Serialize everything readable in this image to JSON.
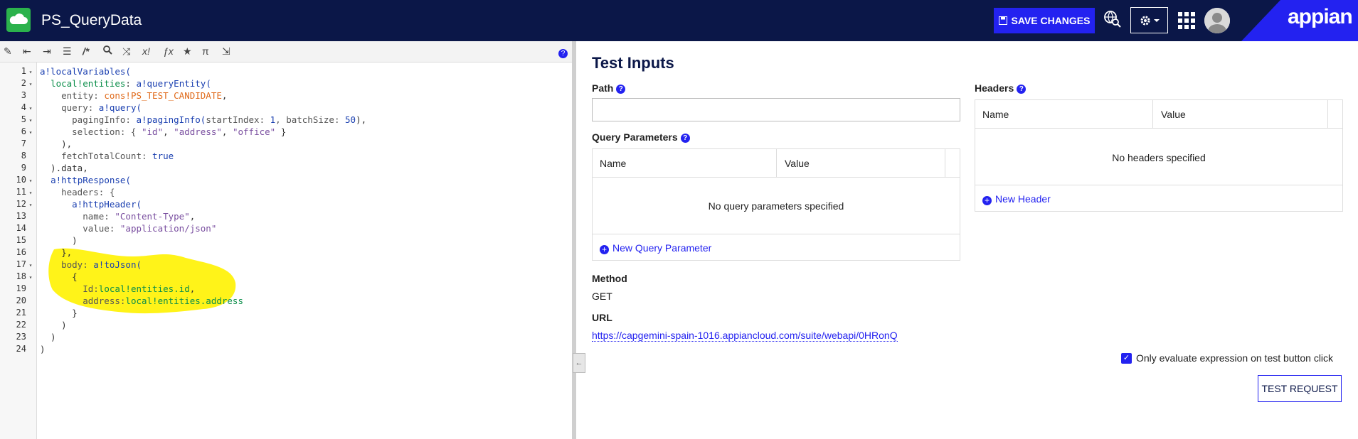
{
  "header": {
    "app_name": "PS_QueryData",
    "save_label": "SAVE CHANGES",
    "brand": "appian"
  },
  "toolbar": {
    "help": "?"
  },
  "editor": {
    "lines": [
      [
        [
          "a!localVariables(",
          "fn"
        ]
      ],
      [
        [
          "  ",
          ""
        ],
        [
          "local!entities",
          "loc"
        ],
        [
          ": ",
          ""
        ],
        [
          "a!queryEntity(",
          "fn"
        ]
      ],
      [
        [
          "    entity: ",
          "key"
        ],
        [
          "cons!PS_TEST_CANDIDATE",
          "cons"
        ],
        [
          ",",
          ""
        ]
      ],
      [
        [
          "    query: ",
          "key"
        ],
        [
          "a!query(",
          "fn"
        ]
      ],
      [
        [
          "      pagingInfo: ",
          "key"
        ],
        [
          "a!pagingInfo(",
          "fn"
        ],
        [
          "startIndex: ",
          "key"
        ],
        [
          "1",
          "num"
        ],
        [
          ", batchSize: ",
          "key"
        ],
        [
          "50",
          "num"
        ],
        [
          "),",
          ""
        ]
      ],
      [
        [
          "      selection: { ",
          "key"
        ],
        [
          "\"id\"",
          "str"
        ],
        [
          ", ",
          ""
        ],
        [
          "\"address\"",
          "str"
        ],
        [
          ", ",
          ""
        ],
        [
          "\"office\"",
          "str"
        ],
        [
          " }",
          ""
        ]
      ],
      [
        [
          "    ),",
          ""
        ]
      ],
      [
        [
          "    fetchTotalCount: ",
          "key"
        ],
        [
          "true",
          "kw"
        ]
      ],
      [
        [
          "  ).data,",
          ""
        ]
      ],
      [
        [
          "  ",
          ""
        ],
        [
          "a!httpResponse(",
          "fn"
        ]
      ],
      [
        [
          "    headers: {",
          "key"
        ]
      ],
      [
        [
          "      ",
          ""
        ],
        [
          "a!httpHeader(",
          "fn"
        ]
      ],
      [
        [
          "        name: ",
          "key"
        ],
        [
          "\"Content-Type\"",
          "str"
        ],
        [
          ",",
          ""
        ]
      ],
      [
        [
          "        value: ",
          "key"
        ],
        [
          "\"application/json\"",
          "str"
        ]
      ],
      [
        [
          "      )",
          ""
        ]
      ],
      [
        [
          "    },",
          ""
        ]
      ],
      [
        [
          "    body: ",
          "key"
        ],
        [
          "a!toJson(",
          "fn"
        ]
      ],
      [
        [
          "      {",
          ""
        ]
      ],
      [
        [
          "        Id:",
          "key"
        ],
        [
          "local!entities.id",
          "loc"
        ],
        [
          ",",
          ""
        ]
      ],
      [
        [
          "        address:",
          "key"
        ],
        [
          "local!entities.address",
          "loc"
        ]
      ],
      [
        [
          "      }",
          ""
        ]
      ],
      [
        [
          "    )",
          ""
        ]
      ],
      [
        [
          "  )",
          ""
        ]
      ],
      [
        [
          ")",
          ""
        ]
      ]
    ],
    "line_numbers": [
      "1",
      "2",
      "3",
      "4",
      "5",
      "6",
      "7",
      "8",
      "9",
      "10",
      "11",
      "12",
      "13",
      "14",
      "15",
      "16",
      "17",
      "18",
      "19",
      "20",
      "21",
      "22",
      "23",
      "24"
    ],
    "fold_lines": [
      "1",
      "2",
      "4",
      "5",
      "6",
      "10",
      "11",
      "12",
      "17",
      "18"
    ]
  },
  "panel": {
    "title": "Test Inputs",
    "path_label": "Path",
    "path_value": "",
    "query_params_label": "Query Parameters",
    "qp_col_name": "Name",
    "qp_col_value": "Value",
    "qp_empty": "No query parameters specified",
    "qp_new": "New Query Parameter",
    "headers_label": "Headers",
    "h_col_name": "Name",
    "h_col_value": "Value",
    "h_empty": "No headers specified",
    "h_new": "New Header",
    "method_label": "Method",
    "method_value": "GET",
    "url_label": "URL",
    "url_value": "https://capgemini-spain-1016.appiancloud.com/suite/webapi/0HRonQ",
    "checkbox_label": "Only evaluate expression on test button click",
    "checkbox_checked": true,
    "test_button": "TEST REQUEST"
  },
  "colors": {
    "navy": "#0b1748",
    "accent": "#2322f0",
    "green": "#2bb24c",
    "highlight": "#fff200"
  }
}
